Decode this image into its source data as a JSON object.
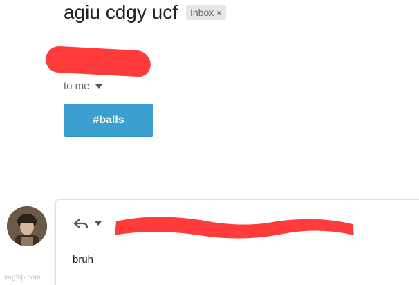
{
  "email": {
    "subject": "agiu cdgy ucf",
    "label": "Inbox",
    "label_remove": "×",
    "recipient_text": "to me",
    "tag_button": "#balls"
  },
  "reply": {
    "body": "bruh"
  },
  "watermark": "imgflip.com",
  "colors": {
    "redaction": "#ff3b3b",
    "tag_button_bg": "#3b9fd0",
    "label_chip_bg": "#e6e6e6"
  },
  "icons": {
    "reply": "reply-icon",
    "dropdown": "chevron-down-icon",
    "label_close": "close-icon"
  }
}
